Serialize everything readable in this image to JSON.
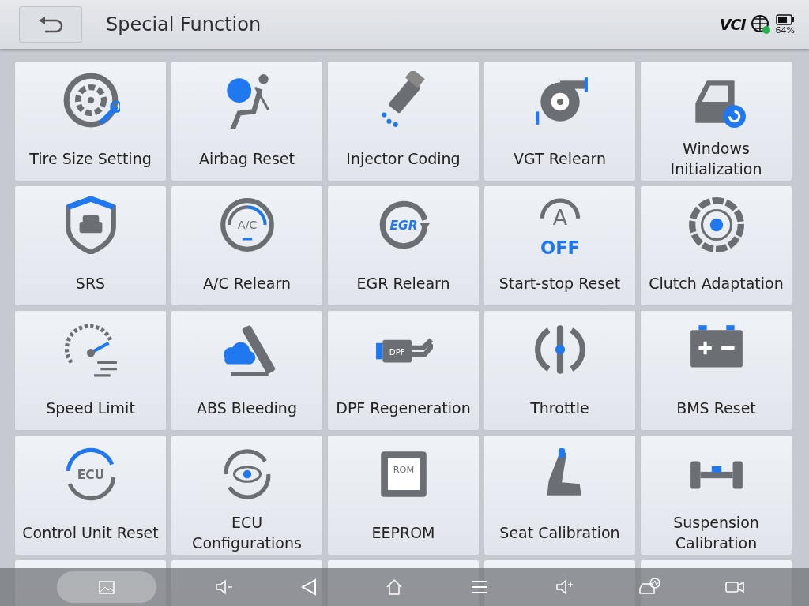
{
  "header": {
    "title": "Special Function",
    "vci_label": "VCI",
    "battery_text": "64%"
  },
  "tiles": [
    {
      "label": "Tire Size Setting"
    },
    {
      "label": "Airbag Reset"
    },
    {
      "label": "Injector Coding"
    },
    {
      "label": "VGT Relearn"
    },
    {
      "label": "Windows Initialization"
    },
    {
      "label": "SRS"
    },
    {
      "label": "A/C Relearn",
      "icon_text": [
        "A/C"
      ]
    },
    {
      "label": "EGR Relearn",
      "icon_text": [
        "EGR"
      ]
    },
    {
      "label": "Start-stop Reset",
      "icon_text": [
        "A",
        "OFF"
      ]
    },
    {
      "label": "Clutch Adaptation"
    },
    {
      "label": "Speed Limit"
    },
    {
      "label": "ABS Bleeding"
    },
    {
      "label": "DPF Regeneration",
      "icon_text": [
        "DPF"
      ]
    },
    {
      "label": "Throttle"
    },
    {
      "label": "BMS Reset"
    },
    {
      "label": "Control Unit Reset",
      "icon_text": [
        "ECU"
      ]
    },
    {
      "label": "ECU Configurations"
    },
    {
      "label": "EEPROM",
      "icon_text": [
        "ROM"
      ]
    },
    {
      "label": "Seat Calibration"
    },
    {
      "label": "Suspension Calibration"
    }
  ]
}
